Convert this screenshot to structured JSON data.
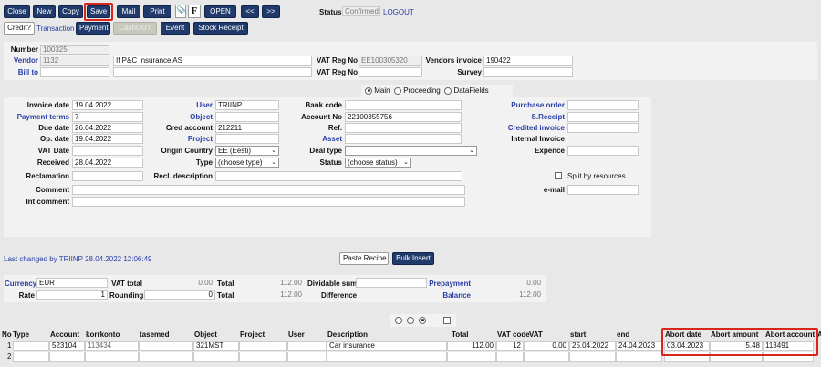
{
  "toolbar": {
    "close": "Close",
    "new": "New",
    "copy": "Copy",
    "save": "Save",
    "mail": "Mail",
    "print": "Print",
    "f_label": "F",
    "open": "OPEN",
    "prev": "<<",
    "next": ">>",
    "status_label": "Status",
    "status_value": "Confirmed",
    "logout": "LOGOUT",
    "credit": "Credit?",
    "transaction": "Transaction",
    "payment": "Payment",
    "cashout": "CashOUT",
    "event": "Event",
    "stock_receipt": "Stock Receipt"
  },
  "header": {
    "number_label": "Number",
    "number": "100325",
    "vendor_label": "Vendor",
    "vendor_code": "1132",
    "vendor_name": "If P&C Insurance AS",
    "vat_reg_label": "VAT Reg No",
    "vat_reg": "EE100305320",
    "vendors_invoice_label": "Vendors invoice",
    "vendors_invoice": "190422",
    "bill_to_label": "Bill to",
    "vat_reg2_label": "VAT Reg No",
    "survey_label": "Survey"
  },
  "tabs": {
    "main": "Main",
    "proceeding": "Proceeding",
    "datafields": "DataFields"
  },
  "form": {
    "invoice_date_label": "Invoice date",
    "invoice_date": "19.04.2022",
    "payment_terms_label": "Payment terms",
    "payment_terms": "7",
    "due_date_label": "Due date",
    "due_date": "26.04.2022",
    "op_date_label": "Op. date",
    "op_date": "19.04.2022",
    "vat_date_label": "VAT Date",
    "received_label": "Received",
    "received": "28.04.2022",
    "reclamation_label": "Reclamation",
    "comment_label": "Comment",
    "int_comment_label": "Int comment",
    "user_label": "User",
    "user": "TRIINP",
    "object_label": "Object",
    "cred_account_label": "Cred account",
    "cred_account": "212211",
    "project_label": "Project",
    "origin_country_label": "Origin Country",
    "origin_country": "EE (Eesti)",
    "type_label": "Type",
    "type": "(choose type)",
    "recl_description_label": "Recl. description",
    "bank_code_label": "Bank code",
    "account_no_label": "Account No",
    "account_no": "22100355756",
    "ref_label": "Ref.",
    "asset_label": "Asset",
    "deal_type_label": "Deal type",
    "status_label": "Status",
    "status": "(choose status)",
    "purchase_order_label": "Purchase order",
    "s_receipt_label": "S.Receipt",
    "credited_invoice_label": "Credited invoice",
    "internal_invoice_label": "Internal Invoice",
    "expence_label": "Expence",
    "split_label": "Split by resources",
    "email_label": "e-mail"
  },
  "changed": {
    "text": "Last changed by  TRIINP 28.04.2022 12:06:49",
    "paste_recipe": "Paste Recipe",
    "bulk_insert": "Bulk Insert"
  },
  "totals": {
    "currency_label": "Currency",
    "currency": "EUR",
    "vat_total_label": "VAT total",
    "vat_total": "0.00",
    "total_label": "Total",
    "total": "112.00",
    "dividable_label": "Dividable sum",
    "prepayment_label": "Prepayment",
    "prepayment": "0.00",
    "rate_label": "Rate",
    "rate": "1",
    "rounding_label": "Rounding",
    "rounding": "0",
    "total2_label": "Total",
    "total2": "112.00",
    "difference_label": "Difference",
    "balance_label": "Balance",
    "balance": "112.00"
  },
  "grid": {
    "headers": [
      "No",
      "Type",
      "Account",
      "korrkonto",
      "tasemed",
      "Object",
      "Project",
      "User",
      "Description",
      "Total",
      "VAT code",
      "VAT",
      "start",
      "end",
      "Abort date",
      "Abort amount",
      "Abort account",
      "A"
    ],
    "rows": [
      {
        "no": "1",
        "account": "523104",
        "korrkonto": "113434",
        "object": "321MST",
        "description": "Car insurance",
        "total": "112.00",
        "vat_code": "12",
        "vat": "0.00",
        "start": "25.04.2022",
        "end": "24.04.2023",
        "abort_date": "03.04.2023",
        "abort_amount": "5.48",
        "abort_account": "113491"
      },
      {
        "no": "2"
      }
    ]
  },
  "colors": {
    "accent": "#1f3a6b",
    "link": "#2b3fa6",
    "highlight": "#d9261c"
  }
}
